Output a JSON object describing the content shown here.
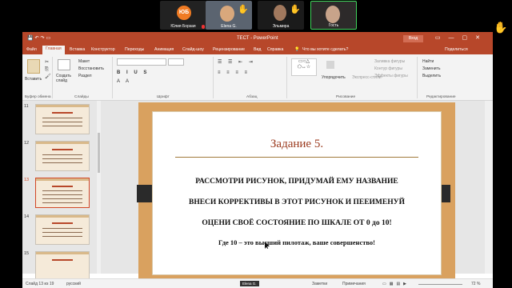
{
  "participants": [
    {
      "name": "Юлия Борзая",
      "initials": "ЮБ"
    },
    {
      "name": "Elena G."
    },
    {
      "name": "Эльмира"
    },
    {
      "name": "Гость"
    }
  ],
  "app": {
    "title": "ТЕСТ  -  PowerPoint",
    "login_label": "Вход",
    "share_label": "Поделиться",
    "search_hint": "Что вы хотите сделать?"
  },
  "tabs": [
    "Файл",
    "Главная",
    "Вставка",
    "Конструктор",
    "Переходы",
    "Анимация",
    "Слайд-шоу",
    "Рецензирование",
    "Вид",
    "Справка"
  ],
  "ribbon": {
    "paste": "Вставить",
    "clipboard_group": "Буфер обмена",
    "create_slide": "Создать слайд",
    "layout": "Макет",
    "restore": "Восстановить",
    "section": "Раздел",
    "slides_group": "Слайды",
    "font_group": "Шрифт",
    "paragraph_group": "Абзац",
    "arrange": "Упорядочить",
    "express_styles": "Экспресс-стили",
    "fill": "Заливка фигуры",
    "outline": "Контур фигуры",
    "effects": "Эффекты фигуры",
    "drawing_group": "Рисование",
    "find": "Найти",
    "replace": "Заменить",
    "select": "Выделить",
    "editing_group": "Редактирование"
  },
  "thumbnails": [
    {
      "num": "11",
      "title": "Задание 6."
    },
    {
      "num": "12",
      "title": "Задание 4."
    },
    {
      "num": "13",
      "title": "Задание 5."
    },
    {
      "num": "14",
      "title": "Замыкания под вашу"
    },
    {
      "num": "15",
      "title": "КТО ИГРА МЕЦ?"
    }
  ],
  "slide": {
    "title": "Задание 5.",
    "line1": "РАССМОТРИ РИСУНОК, ПРИДУМАЙ ЕМУ НАЗВАНИЕ",
    "line2": "ВНЕСИ КОРРЕКТИВЫ В ЭТОТ РИСУНОК И ПЕЕИМЕНУЙ",
    "line3": "ОЦЕНИ СВОЁ СОСТОЯНИЕ ПО ШКАЛЕ ОТ 0 до 10!",
    "line4": "Где 10 – это высший пилотаж, ваше совершенство!"
  },
  "status": {
    "slide_counter": "Слайд 13 из 19",
    "language": "русский",
    "notes": "Заметки",
    "comments": "Примечания",
    "zoom": "72 %"
  },
  "speaker_label": "Elena G.",
  "colors": {
    "accent": "#b7472a",
    "selected_thumb": "#d24726",
    "speaking": "#3fd35b"
  }
}
